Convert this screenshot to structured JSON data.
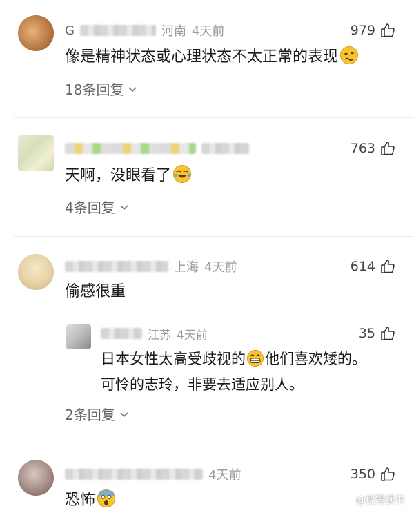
{
  "comments": [
    {
      "name_visible_prefix": "G",
      "location": "河南",
      "time": "4天前",
      "likes": "979",
      "text": "像是精神状态或心理状态不太正常的表现",
      "emoji": "woozy-face",
      "replies_label": "18条回复"
    },
    {
      "location": "",
      "time": "",
      "likes": "763",
      "text": "天啊，没眼看了",
      "emoji": "crying-laughing-face",
      "replies_label": "4条回复"
    },
    {
      "location": "上海",
      "time": "4天前",
      "likes": "614",
      "text": "偷感很重",
      "reply": {
        "location": "江苏",
        "time": "4天前",
        "likes": "35",
        "text_line1": "日本女性太高受歧视的",
        "text_line1_after": "他们喜欢矮的。",
        "text_line2": "可怜的志玲，非要去适应别人。",
        "emoji": "grinning-face"
      },
      "replies_label": "2条回复"
    },
    {
      "location": "",
      "time": "4天前",
      "likes": "350",
      "text": "恐怖",
      "emoji": "screaming-face"
    }
  ],
  "watermark": "@优等读书",
  "colors": {
    "emoji_yellow": "#f7c531",
    "emoji_outline": "#d39a1a",
    "tear_blue": "#5aa6e8"
  }
}
